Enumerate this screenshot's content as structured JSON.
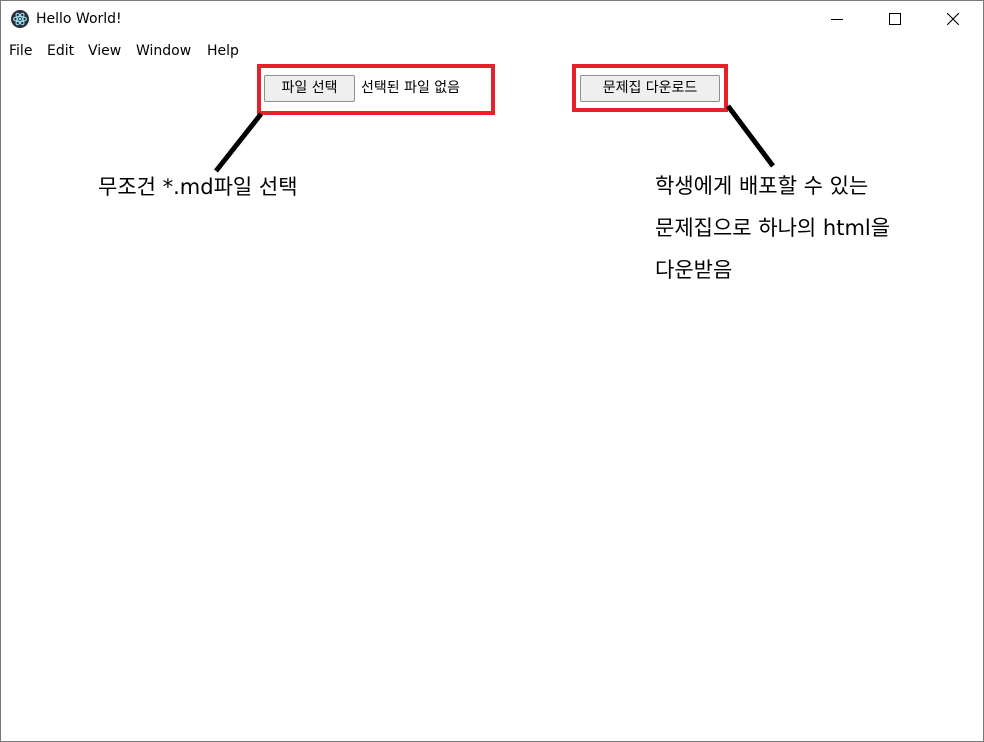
{
  "window": {
    "title": "Hello World!",
    "controls": {
      "minimize": "minimize-icon",
      "maximize": "maximize-icon",
      "close": "close-icon"
    }
  },
  "menu": [
    "File",
    "Edit",
    "View",
    "Window",
    "Help"
  ],
  "file_input": {
    "button_label": "파일 선택",
    "status_text": "선택된 파일 없음"
  },
  "download": {
    "button_label": "문제집 다운로드"
  },
  "annotations": {
    "left_note": "무조건 *.md파일 선택",
    "right_note_lines": [
      "학생에게 배포할 수 있는",
      "문제집으로 하나의 html을",
      "다운받음"
    ]
  },
  "colors": {
    "highlight": "#e8202a",
    "pointer": "#000000",
    "button_bg": "#efefef"
  }
}
